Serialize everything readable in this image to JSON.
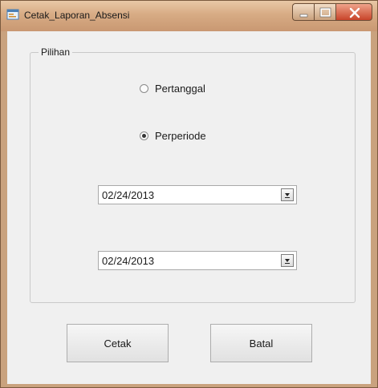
{
  "window": {
    "title": "Cetak_Laporan_Absensi",
    "icon": "form-icon",
    "caption_buttons": [
      "minimize-icon",
      "maximize-icon",
      "close-icon"
    ]
  },
  "group": {
    "label": "Pilihan",
    "options": [
      {
        "label": "Pertanggal",
        "checked": false
      },
      {
        "label": "Perperiode",
        "checked": true
      }
    ]
  },
  "dates": {
    "start": "02/24/2013",
    "end": "02/24/2013"
  },
  "buttons": {
    "print": "Cetak",
    "cancel": "Batal"
  },
  "colors": {
    "titlebar": "#d7ab84",
    "client": "#f0f0f0",
    "close_button": "#c8442a"
  }
}
